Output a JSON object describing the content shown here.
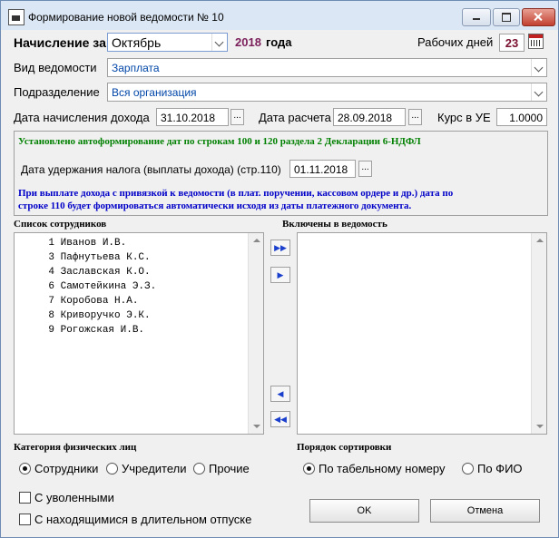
{
  "window": {
    "title": "Формирование новой ведомости № 10"
  },
  "header": {
    "accrual_label": "Начисление за",
    "month": "Октябрь",
    "year": "2018",
    "year_suffix": "года",
    "workdays_label": "Рабочих дней",
    "workdays": "23"
  },
  "form": {
    "statement_type_label": "Вид ведомости",
    "statement_type": "Зарплата",
    "department_label": "Подразделение",
    "department": "Вся организация",
    "income_date_label": "Дата начисления дохода",
    "income_date": "31.10.2018",
    "calc_date_label": "Дата расчета",
    "calc_date": "28.09.2018",
    "rate_label": "Курс в УЕ",
    "rate": "1.0000",
    "dots": "..."
  },
  "notice": {
    "auto_text": "Установлено автоформирование дат по строкам 100 и 120 раздела 2 Декларации 6-НДФЛ",
    "tax_date_label": "Дата удержания налога (выплаты дохода) (стр.110)",
    "tax_date": "01.11.2018",
    "info_line1": "При выплате дохода с привязкой к ведомости (в плат. поручении, кассовом ордере и др.) дата по",
    "info_line2": "строке 110 будет формироваться автоматически исходя из даты платежного документа."
  },
  "lists": {
    "employees_title": "Список сотрудников",
    "included_title": "Включены в ведомость",
    "employees": [
      {
        "num": "1",
        "name": "Иванов И.В."
      },
      {
        "num": "3",
        "name": "Пафнутьева К.С."
      },
      {
        "num": "4",
        "name": "Заславская К.О."
      },
      {
        "num": "6",
        "name": "Самотейкина Э.З."
      },
      {
        "num": "7",
        "name": "Коробова Н.А."
      },
      {
        "num": "8",
        "name": "Криворучко Э.К."
      },
      {
        "num": "9",
        "name": "Рогожская И.В."
      }
    ]
  },
  "category": {
    "title": "Категория физических лиц",
    "options": [
      "Сотрудники",
      "Учредители",
      "Прочие"
    ],
    "selected": "Сотрудники"
  },
  "sort": {
    "title": "Порядок сортировки",
    "options": [
      "По табельному номеру",
      "По ФИО"
    ],
    "selected": "По табельному номеру"
  },
  "checks": {
    "dismissed": "С уволенными",
    "long_leave": "С находящимися в длительном отпуске"
  },
  "buttons": {
    "ok": "OK",
    "cancel": "Отмена"
  },
  "colors": {
    "accent_blue": "#0046a8",
    "notice_green": "#008000",
    "notice_blue": "#0000c8",
    "year_purple": "#7a1f5a",
    "workdays_red": "#7a1030"
  }
}
